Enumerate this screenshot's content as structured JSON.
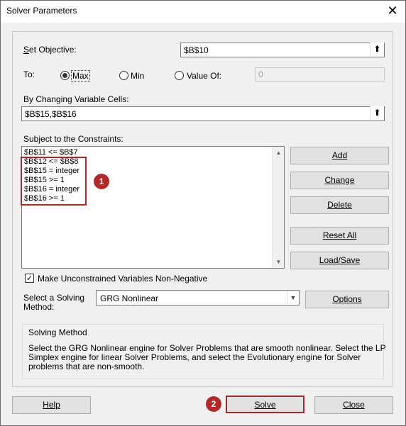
{
  "dialog": {
    "title": "Solver Parameters",
    "close_glyph": "✕"
  },
  "objective": {
    "label": "Set Objective:",
    "value": "$B$10",
    "ref_glyph": "⬆"
  },
  "to": {
    "label": "To:",
    "options": [
      "Max",
      "Min",
      "Value Of:"
    ],
    "selected": "Max",
    "value_of": "0"
  },
  "changing": {
    "label": "By Changing Variable Cells:",
    "value": "$B$15,$B$16"
  },
  "constraints": {
    "label": "Subject to the Constraints:",
    "items": [
      "$B$11 <= $B$7",
      "$B$12 <= $B$8",
      "$B$15 = integer",
      "$B$15 >= 1",
      "$B$16 = integer",
      "$B$16 >= 1"
    ]
  },
  "side_buttons": {
    "add": "Add",
    "change": "Change",
    "delete": "Delete",
    "reset_all": "Reset All",
    "load_save": "Load/Save"
  },
  "nonneg": {
    "label": "Make Unconstrained Variables Non-Negative",
    "checked": true,
    "check_glyph": "✓"
  },
  "method": {
    "label_line1": "Select a Solving",
    "label_line2": "Method:",
    "value": "GRG Nonlinear",
    "options_button": "Options"
  },
  "solving_method": {
    "heading": "Solving Method",
    "text_line1": "Select the GRG Nonlinear engine for Solver Problems that are smooth nonlinear. Select the LP",
    "text_line2": "Simplex engine for linear Solver Problems, and select the Evolutionary engine for Solver",
    "text_line3": "problems that are non-smooth."
  },
  "footer": {
    "help": "Help",
    "solve": "Solve",
    "close": "Close"
  },
  "annotations": {
    "badge1": "1",
    "badge2": "2",
    "highlight_color": "#a12a2a"
  }
}
